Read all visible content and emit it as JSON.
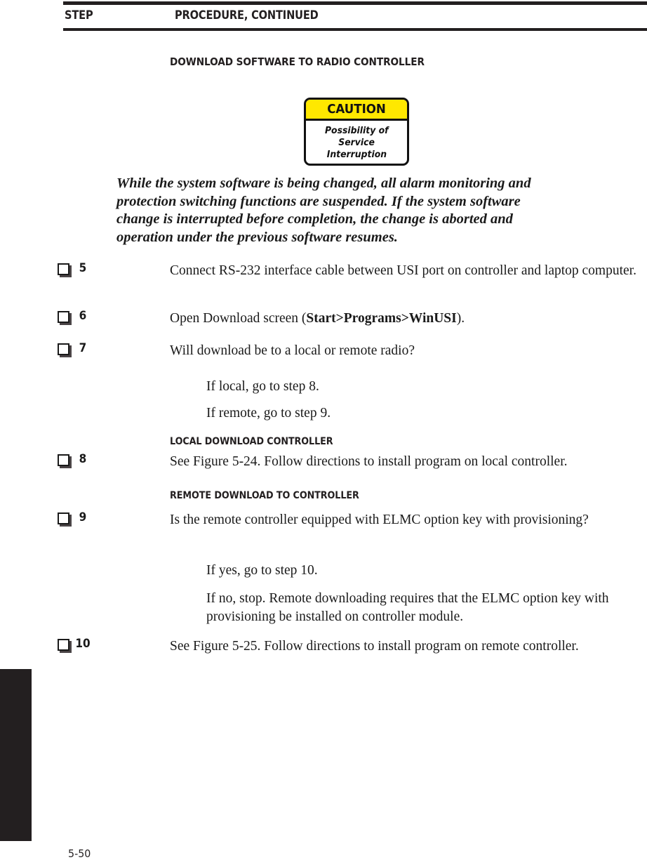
{
  "header": {
    "step_label": "STEP",
    "procedure_label": "PROCEDURE, CONTINUED"
  },
  "main_title": "DOWNLOAD SOFTWARE TO RADIO CONTROLLER",
  "caution": {
    "heading": "CAUTION",
    "line1": "Possibility of",
    "line2": "Service",
    "line3": "Interruption",
    "header_color": "#ffe800",
    "border_color": "#111111"
  },
  "warning_paragraph": {
    "line1": "While the system software is being changed, all alarm monitoring and",
    "line2": "protection switching functions are suspended. If the system software",
    "line3": "change is interrupted before completion, the change is aborted and",
    "line4": "operation under the previous software resumes."
  },
  "steps": [
    {
      "number": "5",
      "text": "Connect RS-232 interface cable between USI port on controller and laptop computer."
    },
    {
      "number": "6",
      "text_before": "Open Download screen (",
      "text_bold": "Start>Programs>WinUSI",
      "text_after": ")."
    },
    {
      "number": "7",
      "text": "Will download be to a local or remote radio?",
      "sub1": "If local, go to step 8.",
      "sub2": "If remote, go to step 9."
    },
    {
      "number": "8",
      "text": "See Figure 5-24. Follow directions to install program on local controller."
    },
    {
      "number": "9",
      "text": "Is the remote controller equipped with ELMC option key with provisioning?",
      "sub1": "If yes, go to step 10.",
      "sub2": "If no, stop. Remote downloading requires that the ELMC option key with provisioning be installed on controller module."
    },
    {
      "number": "10",
      "text": "See Figure 5-25. Follow directions to install program on remote controller."
    }
  ],
  "section_headings": {
    "local": "LOCAL DOWNLOAD CONTROLLER",
    "remote": "REMOTE DOWNLOAD TO CONTROLLER"
  },
  "folio": "5-50"
}
